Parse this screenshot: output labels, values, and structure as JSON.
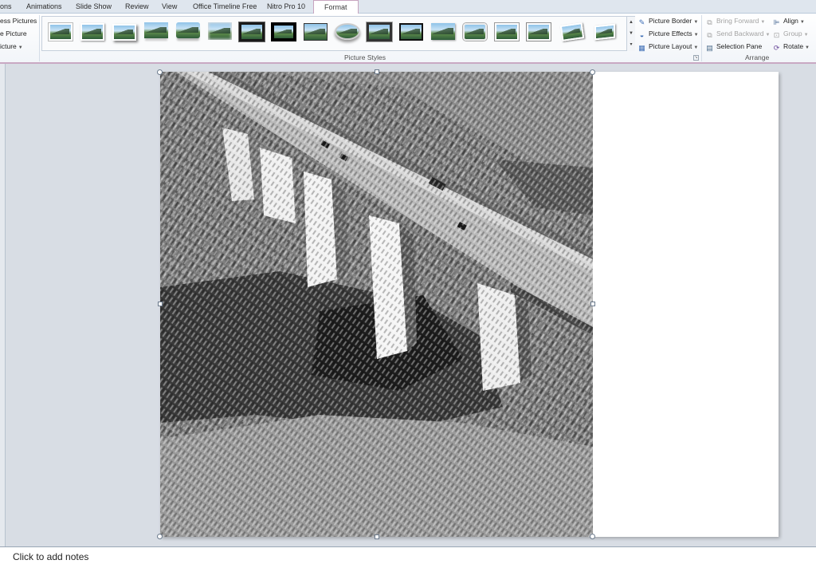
{
  "tabs": [
    {
      "label": "ons",
      "active": false
    },
    {
      "label": "Animations",
      "active": false
    },
    {
      "label": "Slide Show",
      "active": false
    },
    {
      "label": "Review",
      "active": false
    },
    {
      "label": "View",
      "active": false
    },
    {
      "label": "Office Timeline Free",
      "active": false
    },
    {
      "label": "Nitro Pro 10",
      "active": false
    },
    {
      "label": "Format",
      "active": true
    }
  ],
  "adjust": {
    "compress": "ess Pictures",
    "change": "e Picture",
    "reset": "icture"
  },
  "picture_styles": {
    "group_label": "Picture Styles",
    "border": "Picture Border",
    "effects": "Picture Effects",
    "layout": "Picture Layout"
  },
  "arrange": {
    "group_label": "Arrange",
    "bring_forward": "Bring Forward",
    "send_backward": "Send Backward",
    "selection_pane": "Selection Pane",
    "align": "Align",
    "group": "Group",
    "rotate": "Rotate"
  },
  "notes": {
    "placeholder": "Click to add notes"
  },
  "colors": {
    "accent_tab_border": "#c7a4bf",
    "ribbon_bottom": "#c9a8c3",
    "workspace": "#d8dde4"
  },
  "icons": [
    "picture-border-icon",
    "picture-effects-icon",
    "picture-layout-icon",
    "bring-forward-icon",
    "send-backward-icon",
    "selection-pane-icon",
    "align-icon",
    "group-icon",
    "rotate-icon"
  ]
}
